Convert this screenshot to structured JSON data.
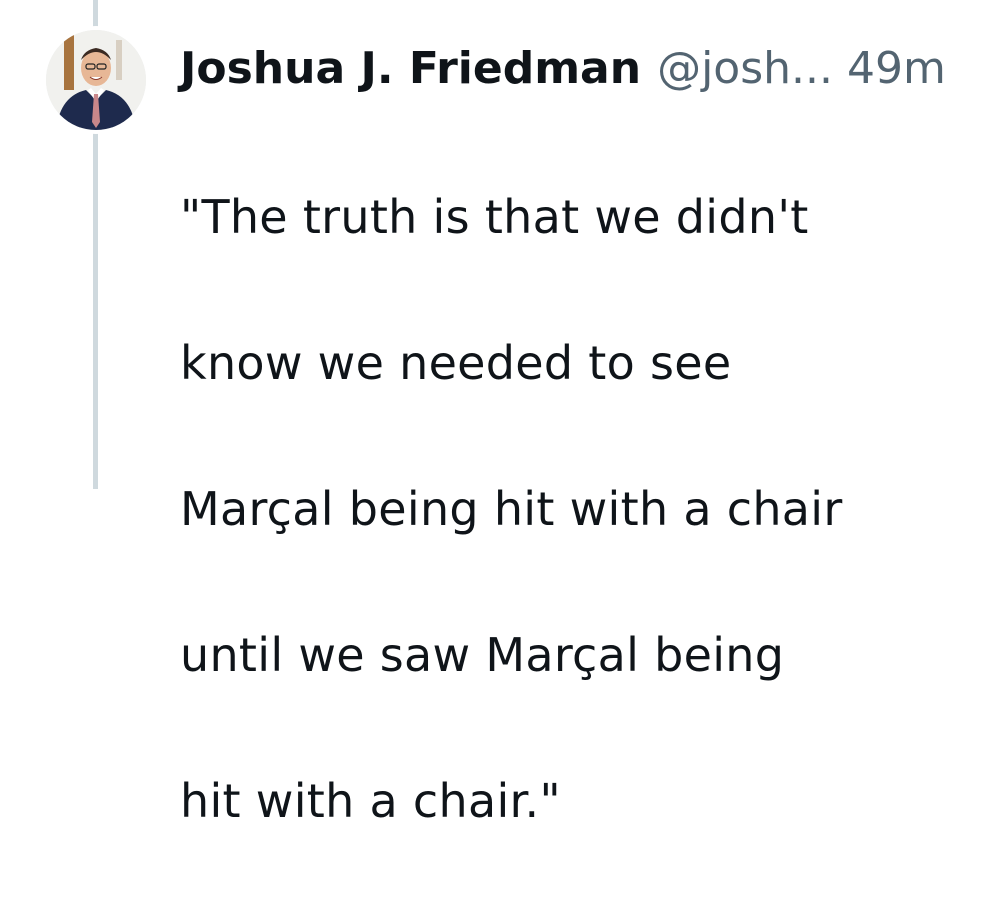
{
  "tweet": {
    "author_name": "Joshua J. Friedman",
    "author_handle": "@josh...",
    "timestamp": "49m",
    "text_lines": [
      "\"The truth is that we didn't",
      "know we needed to see",
      "Marçal being hit with a chair",
      "until we saw Marçal being",
      "hit with a chair.\""
    ]
  },
  "colors": {
    "text_primary": "#0f1419",
    "text_secondary": "#536471",
    "thread_line": "#cfd9de",
    "background": "#ffffff"
  },
  "icons": {
    "avatar": "profile-photo"
  }
}
